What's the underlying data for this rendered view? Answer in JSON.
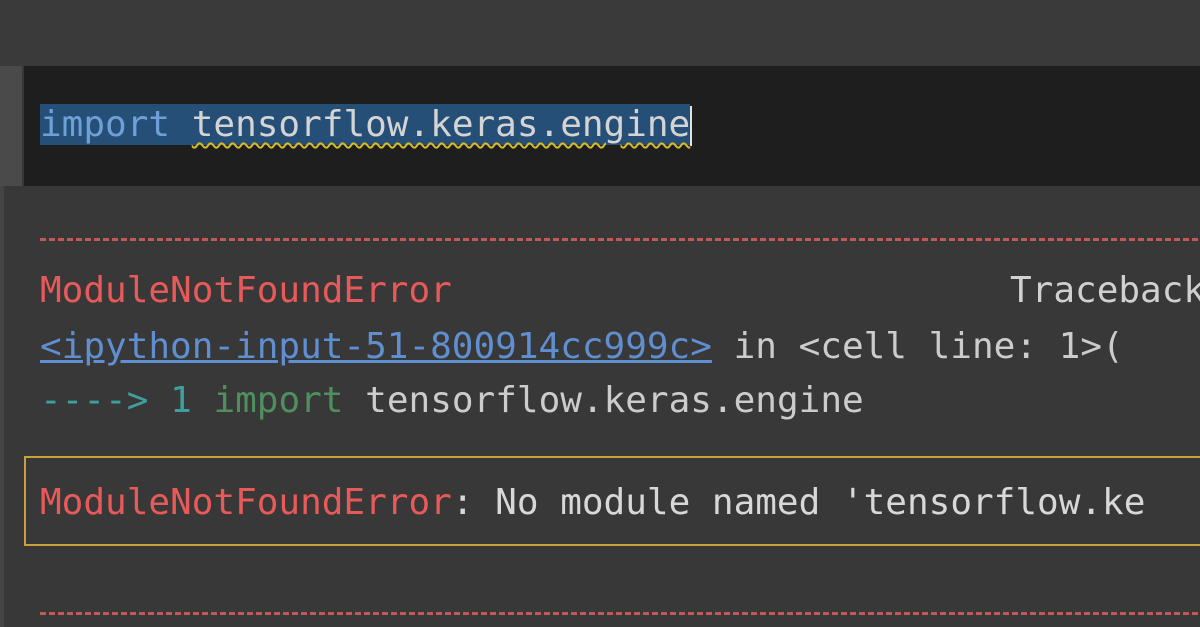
{
  "editor": {
    "keyword": "import",
    "module": "tensorflow.keras.engine"
  },
  "output": {
    "error_name": "ModuleNotFoundError",
    "traceback_label": "Traceback",
    "location_link": "<ipython-input-51-800914cc999c>",
    "location_in": " in ",
    "location_cell": "<cell line: 1>(",
    "arrow": "---->",
    "line_number": "1",
    "code_keyword": "import",
    "code_module": "tensorflow.keras.engine",
    "error_separator": ":",
    "error_message": " No module named 'tensorflow.ke"
  },
  "colors": {
    "error": "#e85a5a",
    "link": "#5f8fd0",
    "selection": "#264f78",
    "warning_border": "#c8a040"
  }
}
